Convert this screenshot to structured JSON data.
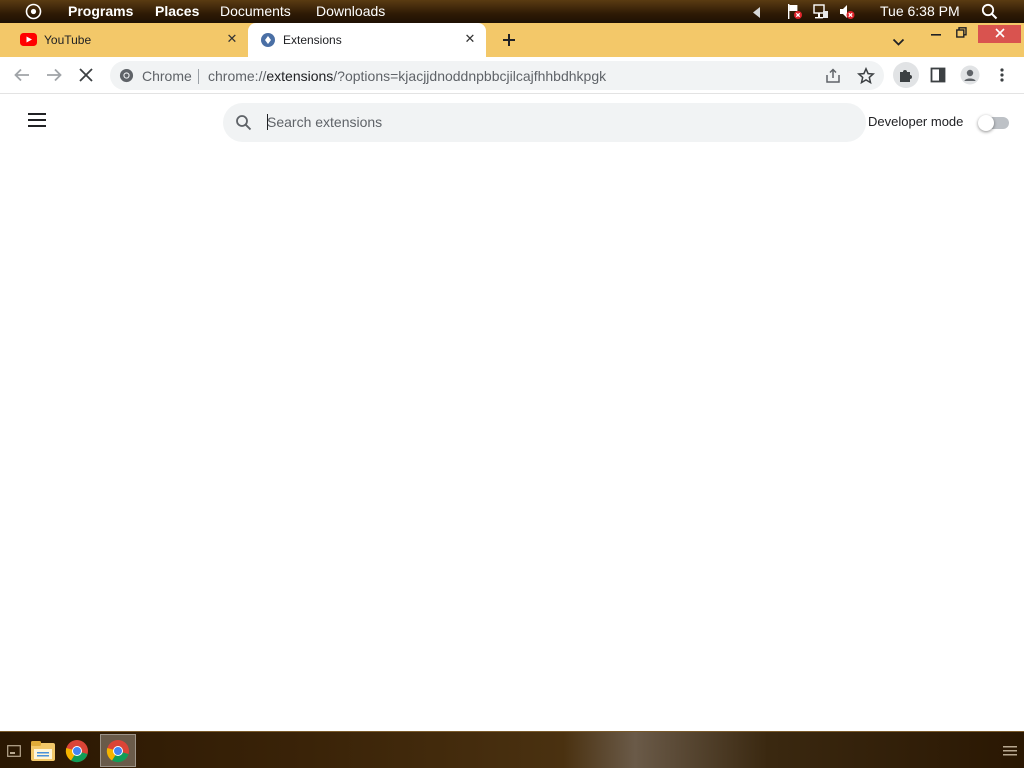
{
  "top_panel": {
    "menus": [
      "Programs",
      "Places",
      "Documents",
      "Downloads"
    ],
    "clock": "Tue 6:38 PM"
  },
  "tabs": [
    {
      "title": "YouTube",
      "active": false
    },
    {
      "title": "Extensions",
      "active": true
    }
  ],
  "toolbar": {
    "omnibox_site": "Chrome",
    "url_scheme": "chrome://",
    "url_host": "extensions",
    "url_rest": "/?options=kjacjjdnoddnpbbcjilcajfhhbdhkpgk"
  },
  "extensions_page": {
    "search_placeholder": "Search extensions",
    "search_value": "",
    "developer_mode_label": "Developer mode",
    "developer_mode_on": false
  },
  "colors": {
    "tab_strip": "#f3c869",
    "close_window": "#d9534f",
    "youtube_red": "#ff0000"
  },
  "icons": {
    "panel": [
      "app-menu-icon",
      "flag-x-icon",
      "network-icon",
      "volume-muted-icon",
      "search-icon"
    ],
    "toolbar": [
      "back-icon",
      "forward-icon",
      "stop-loading-icon",
      "chrome-icon",
      "share-icon",
      "bookmark-star-icon",
      "extensions-puzzle-icon",
      "side-panel-icon",
      "profile-icon",
      "more-vert-icon"
    ],
    "taskbar": [
      "show-desktop-icon",
      "file-manager-icon",
      "chrome-icon",
      "chrome-icon",
      "window-list-icon"
    ]
  }
}
